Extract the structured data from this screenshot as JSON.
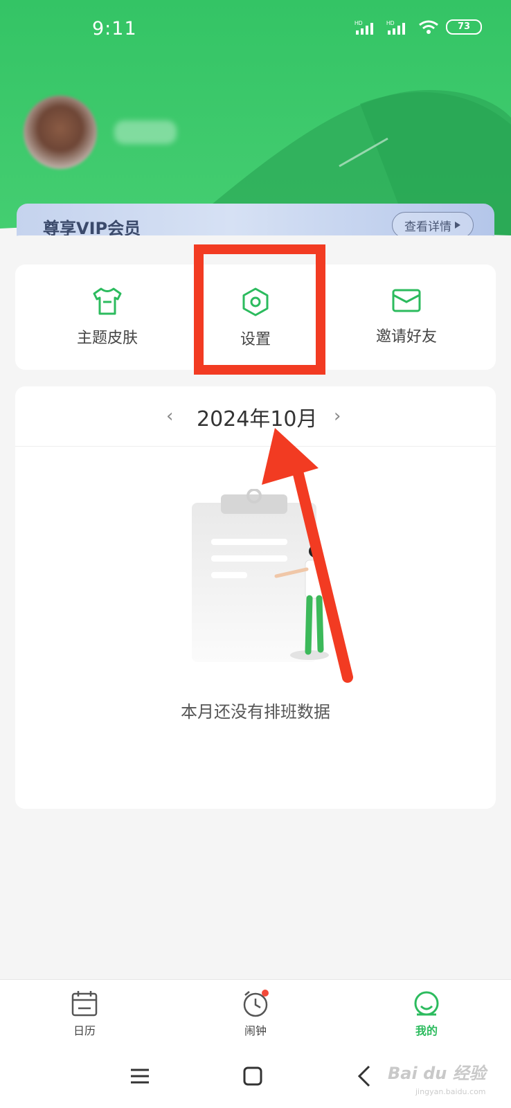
{
  "status_bar": {
    "time": "9:11",
    "battery": "73",
    "signal_label": "HD"
  },
  "vip": {
    "title": "尊享VIP会员",
    "button_label": "查看详情"
  },
  "grid": [
    {
      "label": "主题皮肤",
      "icon": "shirt-icon"
    },
    {
      "label": "设置",
      "icon": "settings-hexagon-icon"
    },
    {
      "label": "邀请好友",
      "icon": "envelope-icon"
    }
  ],
  "calendar": {
    "month_label": "2024年10月",
    "prev_symbol": "‹",
    "next_symbol": "›",
    "empty_text": "本月还没有排班数据"
  },
  "bottom_nav": [
    {
      "label": "日历",
      "icon": "calendar-icon",
      "active": false
    },
    {
      "label": "闹钟",
      "icon": "alarm-clock-icon",
      "active": false
    },
    {
      "label": "我的",
      "icon": "profile-icon",
      "active": true
    }
  ],
  "watermark": {
    "text": "Bai du 经验",
    "sub": "jingyan.baidu.com"
  },
  "colors": {
    "brand_green": "#2cbb5e",
    "highlight_red": "#f23b22"
  }
}
